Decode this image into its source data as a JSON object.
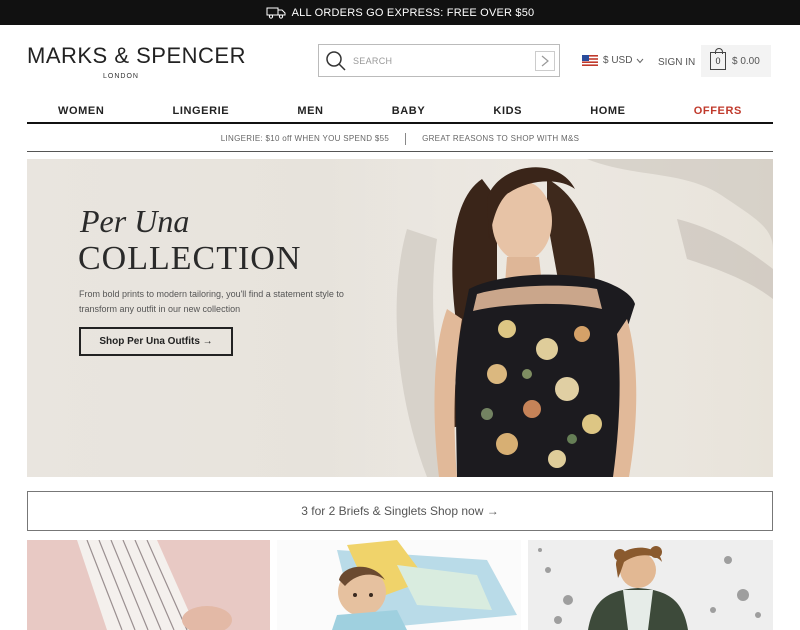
{
  "topbar": {
    "message": "ALL ORDERS GO EXPRESS: FREE OVER $50",
    "icon": "truck-icon"
  },
  "header": {
    "brand": "MARKS & SPENCER",
    "city": "LONDON",
    "search_placeholder": "SEARCH",
    "currency": "$ USD",
    "signin": "SIGN IN",
    "cart_count": "0",
    "cart_total": "$ 0.00"
  },
  "nav": {
    "items": [
      "WOMEN",
      "LINGERIE",
      "MEN",
      "BABY",
      "KIDS",
      "HOME",
      "OFFERS"
    ],
    "offers_color": "#c0392b"
  },
  "promo": {
    "left": "LINGERIE: $10 off WHEN YOU SPEND $55",
    "right": "GREAT REASONS TO SHOP WITH M&S"
  },
  "hero": {
    "title_italic": "Per Una",
    "title_main": "COLLECTION",
    "description": "From bold prints to modern tailoring, you'll find a statement style to transform any outfit in our new collection",
    "cta": "Shop Per Una Outfits →"
  },
  "banner": {
    "text": "3 for 2 Briefs & Singlets Shop now →"
  }
}
